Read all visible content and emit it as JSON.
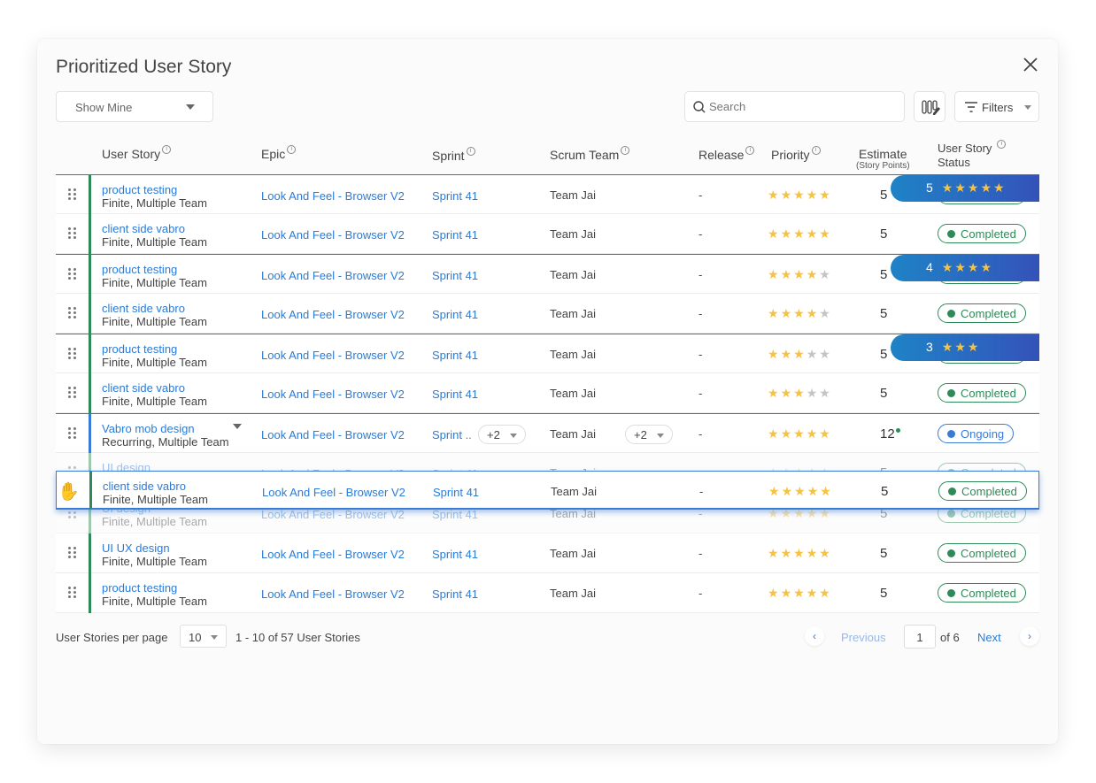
{
  "modal": {
    "title": "Prioritized User Story",
    "view_select": "Show Mine",
    "search_placeholder": "Search",
    "filters_label": "Filters"
  },
  "columns": {
    "user_story": "User Story",
    "epic": "Epic",
    "sprint": "Sprint",
    "scrum_team": "Scrum Team",
    "release": "Release",
    "priority": "Priority",
    "estimate": "Estimate",
    "estimate_sub": "(Story Points)",
    "status_line1": "User Story",
    "status_line2": "Status"
  },
  "rows": [
    {
      "name": "product testing",
      "sub": "Finite, Multiple Team",
      "epic": "Look And Feel - Browser V2",
      "sprint": "Sprint 41",
      "team": "Team Jai",
      "release": "-",
      "priority": 5,
      "estimate": "5",
      "status": "Completed",
      "banner": {
        "value": "5",
        "stars": 5
      }
    },
    {
      "name": "client side vabro",
      "sub": "Finite, Multiple Team",
      "epic": "Look And Feel - Browser V2",
      "sprint": "Sprint 41",
      "team": "Team Jai",
      "release": "-",
      "priority": 5,
      "estimate": "5",
      "status": "Completed"
    },
    {
      "name": "product testing",
      "sub": "Finite, Multiple Team",
      "epic": "Look And Feel - Browser V2",
      "sprint": "Sprint 41",
      "team": "Team Jai",
      "release": "-",
      "priority": 4,
      "estimate": "5",
      "status": "Completed",
      "banner": {
        "value": "4",
        "stars": 4
      }
    },
    {
      "name": "client side vabro",
      "sub": "Finite, Multiple Team",
      "epic": "Look And Feel - Browser V2",
      "sprint": "Sprint 41",
      "team": "Team Jai",
      "release": "-",
      "priority": 4,
      "estimate": "5",
      "status": "Completed"
    },
    {
      "name": "product testing",
      "sub": "Finite, Multiple Team",
      "epic": "Look And Feel - Browser V2",
      "sprint": "Sprint 41",
      "team": "Team Jai",
      "release": "-",
      "priority": 3,
      "estimate": "5",
      "status": "Completed",
      "banner": {
        "value": "3",
        "stars": 3
      }
    },
    {
      "name": "client side vabro",
      "sub": "Finite, Multiple Team",
      "epic": "Look And Feel - Browser V2",
      "sprint": "Sprint 41",
      "team": "Team Jai",
      "release": "-",
      "priority": 3,
      "estimate": "5",
      "status": "Completed"
    },
    {
      "name": "Vabro mob design",
      "sub": "Recurring, Multiple Team",
      "epic": "Look And Feel - Browser V2",
      "sprint": "Sprint ..",
      "sprint_extra": "+2",
      "team": "Team Jai",
      "team_extra": "+2",
      "release": "-",
      "priority": 5,
      "estimate": "12",
      "status": "Ongoing"
    },
    {
      "name": "UI design",
      "sub": "Finite, Multiple Team",
      "epic": "Look And Feel - Browser V2",
      "sprint": "Sprint 41",
      "team": "Team Jai",
      "release": "-",
      "priority": 5,
      "estimate": "5",
      "status": "Completed"
    },
    {
      "name": "UI UX design",
      "sub": "Finite, Multiple Team",
      "epic": "Look And Feel - Browser V2",
      "sprint": "Sprint 41",
      "team": "Team Jai",
      "release": "-",
      "priority": 5,
      "estimate": "5",
      "status": "Completed"
    },
    {
      "name": "product testing",
      "sub": "Finite, Multiple Team",
      "epic": "Look And Feel - Browser V2",
      "sprint": "Sprint 41",
      "team": "Team Jai",
      "release": "-",
      "priority": 5,
      "estimate": "5",
      "status": "Completed"
    }
  ],
  "dragging_row": {
    "name": "client side vabro",
    "sub": "Finite, Multiple Team",
    "epic": "Look And Feel - Browser V2",
    "sprint": "Sprint 41",
    "team": "Team Jai",
    "release": "-",
    "priority": 5,
    "estimate": "5",
    "status": "Completed"
  },
  "footer": {
    "per_page_label": "User Stories per page",
    "per_page_value": "10",
    "range_text": "1 - 10 of 57 User Stories",
    "previous": "Previous",
    "page": "1",
    "of_pages": "of 6",
    "next": "Next"
  },
  "colors": {
    "accent": "#2b7bd8",
    "completed": "#2e8b57",
    "ongoing": "#3a7bd5",
    "star": "#f5c242"
  }
}
